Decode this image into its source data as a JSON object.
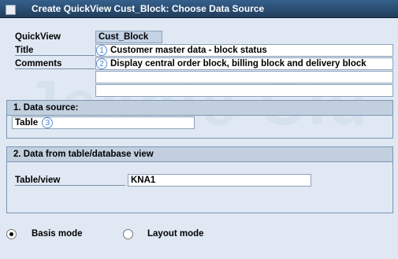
{
  "window": {
    "title": "Create QuickView Cust_Block: Choose Data Source"
  },
  "header": {
    "quickview_label": "QuickView",
    "quickview_value": "Cust_Block",
    "title_label": "Title",
    "title_value": "Customer master data - block status",
    "title_marker": "1",
    "comments_label": "Comments",
    "comments_value": "Display central order block, billing block and delivery block",
    "comments_marker": "2",
    "comments_line2": "",
    "comments_line3": ""
  },
  "data_source": {
    "heading": "1. Data source:",
    "value": "Table",
    "marker": "3"
  },
  "table_group": {
    "heading": "2. Data from table/database view",
    "field_label": "Table/view",
    "field_value": "KNA1"
  },
  "mode": {
    "basis_label": "Basis mode",
    "layout_label": "Layout mode",
    "selected": "Basis mode"
  },
  "watermark": {
    "text": "Jeanie Clu"
  }
}
